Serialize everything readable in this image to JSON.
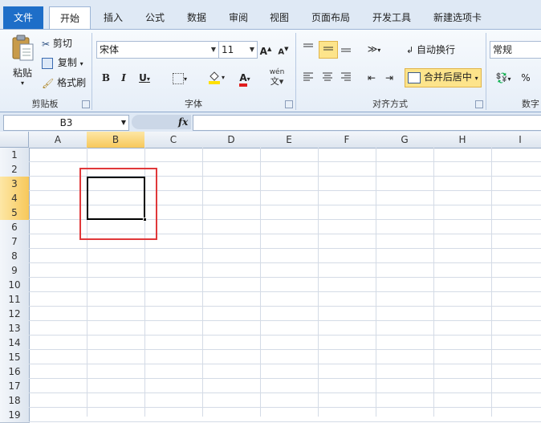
{
  "tabs": [
    "文件",
    "开始",
    "插入",
    "公式",
    "数据",
    "审阅",
    "视图",
    "页面布局",
    "开发工具",
    "新建选项卡"
  ],
  "clipboard": {
    "paste": "粘贴",
    "cut": "剪切",
    "copy": "复制",
    "format_painter": "格式刷",
    "group": "剪贴板"
  },
  "font": {
    "name": "宋体",
    "size": "11",
    "bold": "B",
    "italic": "I",
    "underline": "U",
    "group": "字体",
    "grow": "A",
    "shrink": "A",
    "font_color_letter": "A",
    "phonetic": "wén"
  },
  "alignment": {
    "wrap": "自动换行",
    "merge": "合并后居中",
    "group": "对齐方式"
  },
  "number": {
    "format": "常规",
    "percent": "%",
    "group": "数字"
  },
  "formula_bar": {
    "name_box": "B3",
    "fx": "fx"
  },
  "columns": [
    "A",
    "B",
    "C",
    "D",
    "E",
    "F",
    "G",
    "H",
    "I"
  ],
  "rows": [
    "1",
    "2",
    "3",
    "4",
    "5",
    "6",
    "7",
    "8",
    "9",
    "10",
    "11",
    "12",
    "13",
    "14",
    "15",
    "16",
    "17",
    "18",
    "19"
  ],
  "colors": {
    "accent": "#1e6ec8",
    "highlight": "#f7c85a",
    "annotation": "#e0383a",
    "font_color": "#e01e1e",
    "fill_color": "#ffe000"
  }
}
